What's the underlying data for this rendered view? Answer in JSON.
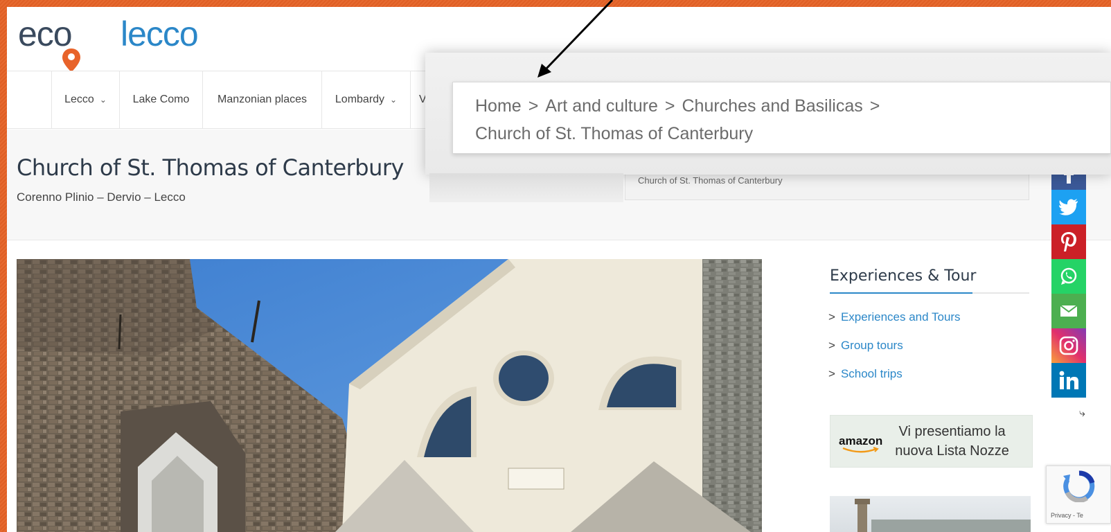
{
  "logo": {
    "part1": "eco",
    "part2": "lecco"
  },
  "nav": {
    "items": [
      {
        "label": "Lecco",
        "has_dropdown": true
      },
      {
        "label": "Lake Como",
        "has_dropdown": false
      },
      {
        "label": "Manzonian places",
        "has_dropdown": false
      },
      {
        "label": "Lombardy",
        "has_dropdown": true
      },
      {
        "label": "V",
        "has_dropdown": false
      }
    ]
  },
  "page": {
    "title": "Church of St. Thomas of Canterbury",
    "subtitle": "Corenno Plinio – Dervio – Lecco"
  },
  "breadcrumb": {
    "items": [
      "Home",
      "Art and culture",
      "Churches and Basilicas",
      "Church of St. Thomas of Canterbury"
    ],
    "separator": ">"
  },
  "sidebar": {
    "title": "Experiences & Tour",
    "links": [
      "Experiences and Tours",
      "Group tours",
      "School trips"
    ],
    "amazon": {
      "logo": "amazon",
      "text_line1": "Vi presentiamo la",
      "text_line2": "nuova Lista Nozze"
    }
  },
  "social": [
    {
      "name": "facebook-icon",
      "color": "#3b5998"
    },
    {
      "name": "twitter-icon",
      "color": "#1da1f2"
    },
    {
      "name": "pinterest-icon",
      "color": "#cb2027"
    },
    {
      "name": "whatsapp-icon",
      "color": "#25d366"
    },
    {
      "name": "email-icon",
      "color": "#4caf50"
    },
    {
      "name": "instagram-icon",
      "color": "#c13584"
    },
    {
      "name": "linkedin-icon",
      "color": "#0077b5"
    }
  ],
  "recaptcha": {
    "text": "Privacy - Te"
  },
  "colors": {
    "frame": "#e2632a",
    "accent": "#2b87c8",
    "title": "#2e3b4a"
  }
}
